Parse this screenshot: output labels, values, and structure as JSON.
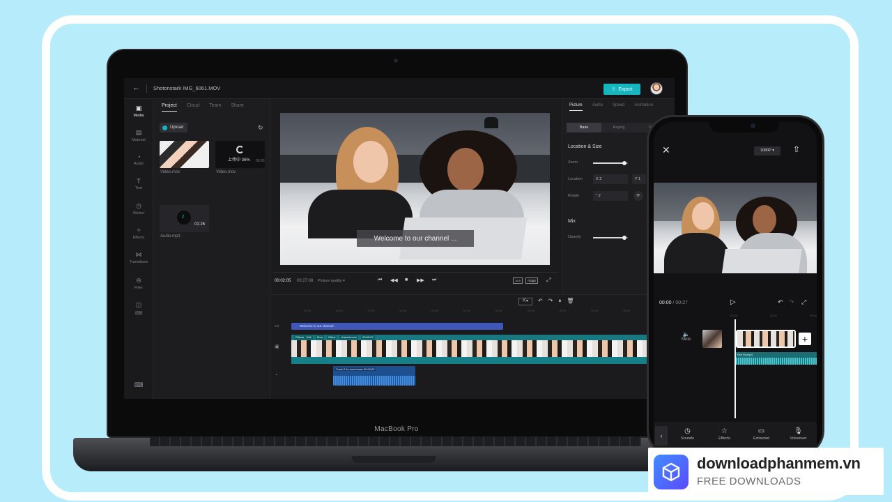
{
  "editor": {
    "file_name": "Shotonstark IMG_6061.MOV",
    "export_label": "Export",
    "rail": [
      {
        "label": "Media",
        "icon": "media-icon"
      },
      {
        "label": "Material",
        "icon": "material-icon"
      },
      {
        "label": "Audio",
        "icon": "audio-icon"
      },
      {
        "label": "Text",
        "icon": "text-icon"
      },
      {
        "label": "Sticker",
        "icon": "sticker-icon"
      },
      {
        "label": "Effects",
        "icon": "effects-icon"
      },
      {
        "label": "Transitions",
        "icon": "transitions-icon"
      },
      {
        "label": "Filter",
        "icon": "filter-icon"
      },
      {
        "label": "调整",
        "icon": "adjust-icon"
      }
    ],
    "panel_tabs": [
      "Project",
      "Cloud",
      "Team",
      "Share"
    ],
    "upload_label": "Upload",
    "media": [
      {
        "name": "Video.mov"
      },
      {
        "name": "Video.mov",
        "progress_text": "上传中 36%",
        "time": "00:20"
      },
      {
        "name": "Audio.mp3",
        "duration": "01:26"
      }
    ],
    "preview": {
      "caption": "Welcome to our channel ...",
      "time_current": "00:02:05",
      "time_total": "00:27:08",
      "quality": "Picture quality",
      "ratio": "16:9",
      "scale": "Adapt"
    },
    "props": {
      "tabs": [
        "Picture",
        "Audio",
        "Speed",
        "Animation"
      ],
      "sub_tabs": [
        "Base",
        "Keying",
        "Mask"
      ],
      "section_location": "Location & Size",
      "zoom_label": "Zoom",
      "location_label": "Location",
      "rotate_label": "Rotate",
      "x_value": "X 2",
      "y_value": "Y 1",
      "rotate_value": "° 2",
      "section_mix": "Mix",
      "opacity_label": "Opacity",
      "zoom_level": 0.9,
      "opacity_level": 0.9
    },
    "timeline": {
      "ruler": [
        "00:00",
        "00:05",
        "00:10",
        "00:15",
        "00:20",
        "00:25",
        "00:30",
        "00:35",
        "00:40",
        "00:45",
        "00:50",
        "00:55"
      ],
      "text_clip": "Welcome to our channel",
      "video_chips": [
        "Effects · Edit",
        "Slow",
        "Effect",
        "channel.mov",
        "00:00:00"
      ],
      "audio_chips": [
        "Track 2.4s",
        "sound.wav",
        "00:00:05"
      ]
    },
    "laptop_model": "MacBook Pro"
  },
  "phone": {
    "resolution": "1080P",
    "time_current": "00:00",
    "time_total": "00:27",
    "ruler": [
      "00:00",
      "00:02",
      "00:04"
    ],
    "mute_label": "Mute",
    "audio_label": "Fire Fly.mp3",
    "tools": [
      {
        "label": "Sounds",
        "icon": "sounds-icon"
      },
      {
        "label": "Effects",
        "icon": "effects-icon"
      },
      {
        "label": "Extracted",
        "icon": "extracted-icon"
      },
      {
        "label": "Voiceover",
        "icon": "voiceover-icon"
      }
    ]
  },
  "badge": {
    "title": "downloadphanmem.vn",
    "subtitle": "FREE DOWNLOADS"
  },
  "colors": {
    "background": "#b5ebfb",
    "accent": "#17b5c0",
    "text_clip": "#3f57b8"
  }
}
